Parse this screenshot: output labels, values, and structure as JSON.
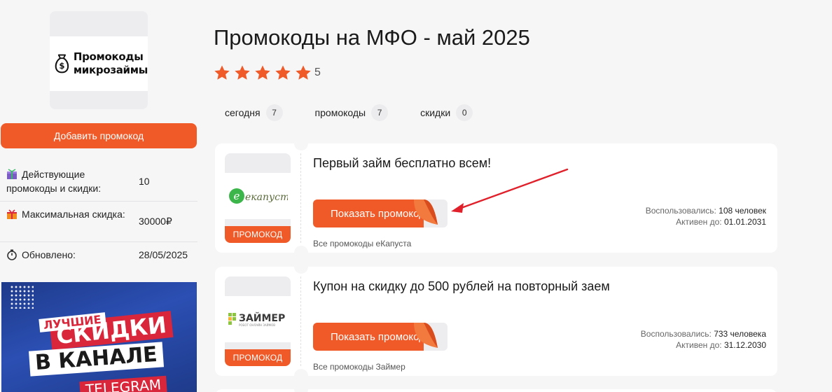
{
  "sidebar": {
    "logo_text_line1": "Промокоды",
    "logo_text_line2": "микрозаймы",
    "add_button": "Добавить промокод",
    "info": [
      {
        "icon": "gift-box-icon",
        "label": "Действующие промокоды и скидки:",
        "value": "10"
      },
      {
        "icon": "gift-icon",
        "label": "Максимальная скидка:",
        "value": "30000₽"
      },
      {
        "icon": "stopwatch-icon",
        "label": "Обновлено:",
        "value": "28/05/2025"
      }
    ],
    "banner": {
      "line1": "ЛУЧШИЕ",
      "line2": "СКИДКИ",
      "line3": "В КАНАЛЕ",
      "line4": "TELEGRAM"
    }
  },
  "main": {
    "title": "Промокоды на МФО - май 2025",
    "rating": "5",
    "rating_stars": 5,
    "tabs": [
      {
        "label": "сегодня",
        "count": "7"
      },
      {
        "label": "промокоды",
        "count": "7"
      },
      {
        "label": "скидки",
        "count": "0"
      }
    ],
    "offers": [
      {
        "logo": "екапуста",
        "tag": "ПРОМОКОД",
        "title": "Первый займ бесплатно всем!",
        "button": "Показать промокод",
        "used_label": "Воспользовались:",
        "used_value": "108 человек",
        "active_label": "Активен до:",
        "active_value": "01.01.2031",
        "all_link": "Все промокоды еКапуста"
      },
      {
        "logo": "ЗАЙМЕР",
        "logo_sub": "РОБОТ ОНЛАЙН ЗАЙМОВ",
        "tag": "ПРОМОКОД",
        "title": "Купон на скидку до 500 рублей на повторный заем",
        "button": "Показать промокод",
        "used_label": "Воспользовались:",
        "used_value": "733 человека",
        "active_label": "Активен до:",
        "active_value": "31.12.2030",
        "all_link": "Все промокоды Займер"
      }
    ]
  },
  "colors": {
    "accent": "#f05a28",
    "arrow": "#e0202a",
    "banner": "#1e3a8a"
  }
}
